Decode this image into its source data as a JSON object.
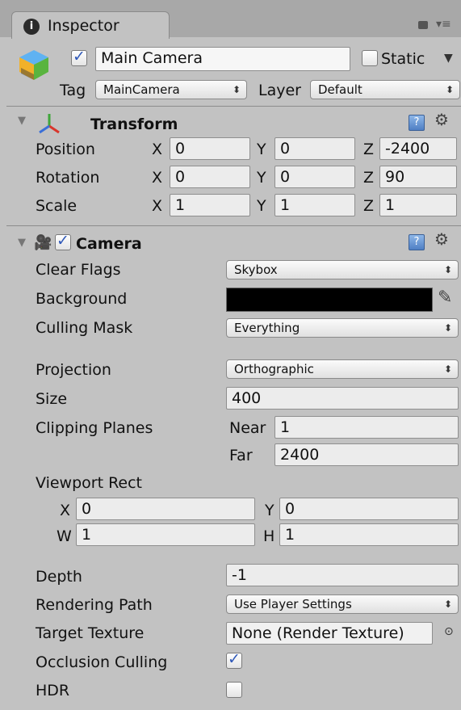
{
  "tab": {
    "icon": "info-icon",
    "label": "Inspector"
  },
  "window_controls": {
    "lock_icon": "lock-icon",
    "menu_icon": "menu-icon"
  },
  "object": {
    "icon": "gameobject-cube-icon",
    "active": true,
    "name": "Main Camera",
    "static_label": "Static",
    "static_checked": false,
    "tag_label": "Tag",
    "tag_value": "MainCamera",
    "layer_label": "Layer",
    "layer_value": "Default"
  },
  "transform": {
    "title": "Transform",
    "icon": "transform-axes-icon",
    "rows": [
      {
        "label": "Position",
        "x": "0",
        "y": "0",
        "z": "-2400"
      },
      {
        "label": "Rotation",
        "x": "0",
        "y": "0",
        "z": "90"
      },
      {
        "label": "Scale",
        "x": "1",
        "y": "1",
        "z": "1"
      }
    ],
    "axis": {
      "x": "X",
      "y": "Y",
      "z": "Z"
    }
  },
  "camera": {
    "title": "Camera",
    "icon": "camera-icon",
    "enabled": true,
    "clear_flags": {
      "label": "Clear Flags",
      "value": "Skybox"
    },
    "background": {
      "label": "Background",
      "color": "#000000"
    },
    "culling_mask": {
      "label": "Culling Mask",
      "value": "Everything"
    },
    "projection": {
      "label": "Projection",
      "value": "Orthographic"
    },
    "size": {
      "label": "Size",
      "value": "400"
    },
    "clipping": {
      "label": "Clipping Planes",
      "near_label": "Near",
      "near": "1",
      "far_label": "Far",
      "far": "2400"
    },
    "viewport": {
      "label": "Viewport Rect",
      "x_label": "X",
      "x": "0",
      "y_label": "Y",
      "y": "0",
      "w_label": "W",
      "w": "1",
      "h_label": "H",
      "h": "1"
    },
    "depth": {
      "label": "Depth",
      "value": "-1"
    },
    "rendering_path": {
      "label": "Rendering Path",
      "value": "Use Player Settings"
    },
    "target_texture": {
      "label": "Target Texture",
      "value": "None (Render Texture)"
    },
    "occlusion_culling": {
      "label": "Occlusion Culling",
      "checked": true
    },
    "hdr": {
      "label": "HDR",
      "checked": false
    }
  }
}
